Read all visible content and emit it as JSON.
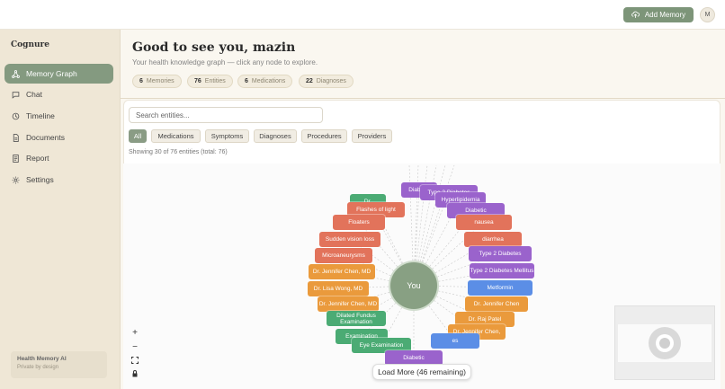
{
  "topbar": {
    "add_memory_label": "Add Memory",
    "avatar_initial": "M"
  },
  "sidebar": {
    "brand": "Cognure",
    "items": [
      {
        "label": "Memory Graph",
        "icon": "graph-icon",
        "active": true
      },
      {
        "label": "Chat",
        "icon": "chat-icon",
        "active": false
      },
      {
        "label": "Timeline",
        "icon": "clock-icon",
        "active": false
      },
      {
        "label": "Documents",
        "icon": "document-icon",
        "active": false
      },
      {
        "label": "Report",
        "icon": "report-icon",
        "active": false
      },
      {
        "label": "Settings",
        "icon": "gear-icon",
        "active": false
      }
    ],
    "footer_title": "Health Memory AI",
    "footer_subtitle": "Private by design"
  },
  "header": {
    "greeting": "Good to see you, mazin",
    "subtitle": "Your health knowledge graph — click any node to explore.",
    "stats": [
      {
        "count": "6",
        "label": "Memories"
      },
      {
        "count": "76",
        "label": "Entities"
      },
      {
        "count": "6",
        "label": "Medications"
      },
      {
        "count": "22",
        "label": "Diagnoses"
      }
    ]
  },
  "search": {
    "placeholder": "Search entities..."
  },
  "filters": [
    "All",
    "Medications",
    "Symptoms",
    "Diagnoses",
    "Procedures",
    "Providers"
  ],
  "showing_text": "Showing 30 of 76 entities (total: 76)",
  "graph": {
    "center_label": "You",
    "nodes": [
      {
        "label": "Diabetic",
        "type": "diagnosis"
      },
      {
        "label": "Dr.",
        "type": "procedure"
      },
      {
        "label": "Type 2 Diabetes",
        "type": "diagnosis"
      },
      {
        "label": "Hyperlipidemia",
        "type": "diagnosis"
      },
      {
        "label": "Flashes of light",
        "type": "symptom"
      },
      {
        "label": "Diabetic",
        "type": "diagnosis"
      },
      {
        "label": "Floaters",
        "type": "symptom"
      },
      {
        "label": "nausea",
        "type": "symptom"
      },
      {
        "label": "Sudden vision loss",
        "type": "symptom"
      },
      {
        "label": "diarrhea",
        "type": "symptom"
      },
      {
        "label": "Microaneurysms",
        "type": "symptom"
      },
      {
        "label": "Type 2 Diabetes",
        "type": "diagnosis"
      },
      {
        "label": "Dr. Jennifer Chen, MD",
        "type": "provider"
      },
      {
        "label": "Type 2 Diabetes Mellitus",
        "type": "diagnosis"
      },
      {
        "label": "Dr. Lisa Wong, MD",
        "type": "provider"
      },
      {
        "label": "Metformin",
        "type": "medication"
      },
      {
        "label": "Dr. Jennifer Chen, MD",
        "type": "provider"
      },
      {
        "label": "Dr. Jennifer Chen",
        "type": "provider"
      },
      {
        "label": "Dilated Fundus Examination",
        "type": "procedure"
      },
      {
        "label": "Dr. Raj Patel",
        "type": "provider"
      },
      {
        "label": "Examination",
        "type": "procedure"
      },
      {
        "label": "Dr. Jennifer Chen,",
        "type": "provider"
      },
      {
        "label": "Eye Examination",
        "type": "procedure"
      },
      {
        "label": "es",
        "type": "medication"
      },
      {
        "label": "Diabetic",
        "type": "diagnosis"
      }
    ]
  },
  "load_more_label": "Load More (46 remaining)",
  "colors": {
    "accent": "#7d9579",
    "diagnosis": "#9a63cc",
    "symptom": "#e2735b",
    "provider": "#ea9a3c",
    "medication": "#5b8ee6",
    "procedure": "#4bab74"
  }
}
